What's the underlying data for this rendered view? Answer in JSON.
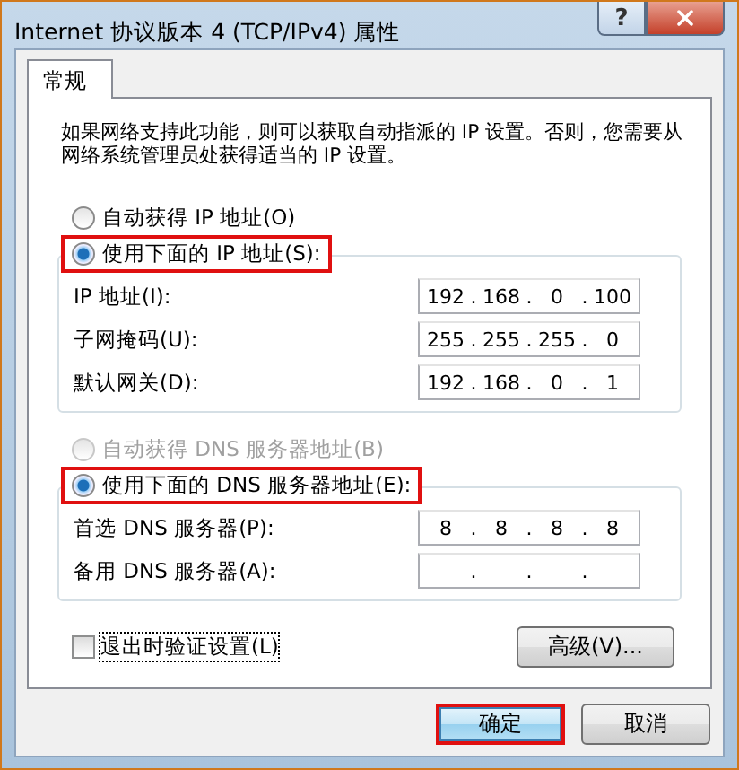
{
  "window": {
    "title": "Internet 协议版本 4 (TCP/IPv4) 属性",
    "help_button": "?"
  },
  "tabs": [
    {
      "label": "常规",
      "selected": true
    }
  ],
  "description": "如果网络支持此功能，则可以获取自动指派的 IP 设置。否则，您需要从网络系统管理员处获得适当的 IP 设置。",
  "ip_separator": ".",
  "sections": [
    {
      "auto_option": {
        "label": "自动获得 IP 地址(O)",
        "selected": false,
        "disabled": false,
        "highlighted": false
      },
      "manual_option": {
        "label": "使用下面的 IP 地址(S):",
        "selected": true,
        "disabled": false,
        "highlighted": true
      },
      "fields": [
        {
          "label": "IP 地址(I):",
          "octets": [
            "192",
            "168",
            "0",
            "100"
          ]
        },
        {
          "label": "子网掩码(U):",
          "octets": [
            "255",
            "255",
            "255",
            "0"
          ]
        },
        {
          "label": "默认网关(D):",
          "octets": [
            "192",
            "168",
            "0",
            "1"
          ]
        }
      ]
    },
    {
      "auto_option": {
        "label": "自动获得 DNS 服务器地址(B)",
        "selected": false,
        "disabled": true,
        "highlighted": false
      },
      "manual_option": {
        "label": "使用下面的 DNS 服务器地址(E):",
        "selected": true,
        "disabled": false,
        "highlighted": true
      },
      "fields": [
        {
          "label": "首选 DNS 服务器(P):",
          "octets": [
            "8",
            "8",
            "8",
            "8"
          ]
        },
        {
          "label": "备用 DNS 服务器(A):"
        }
      ]
    }
  ],
  "validate_checkbox": {
    "label": "退出时验证设置(L)",
    "checked": false
  },
  "advanced_button": "高级(V)...",
  "buttons": [
    {
      "label": "确定",
      "highlighted": true
    },
    {
      "label": "取消",
      "highlighted": false
    }
  ]
}
